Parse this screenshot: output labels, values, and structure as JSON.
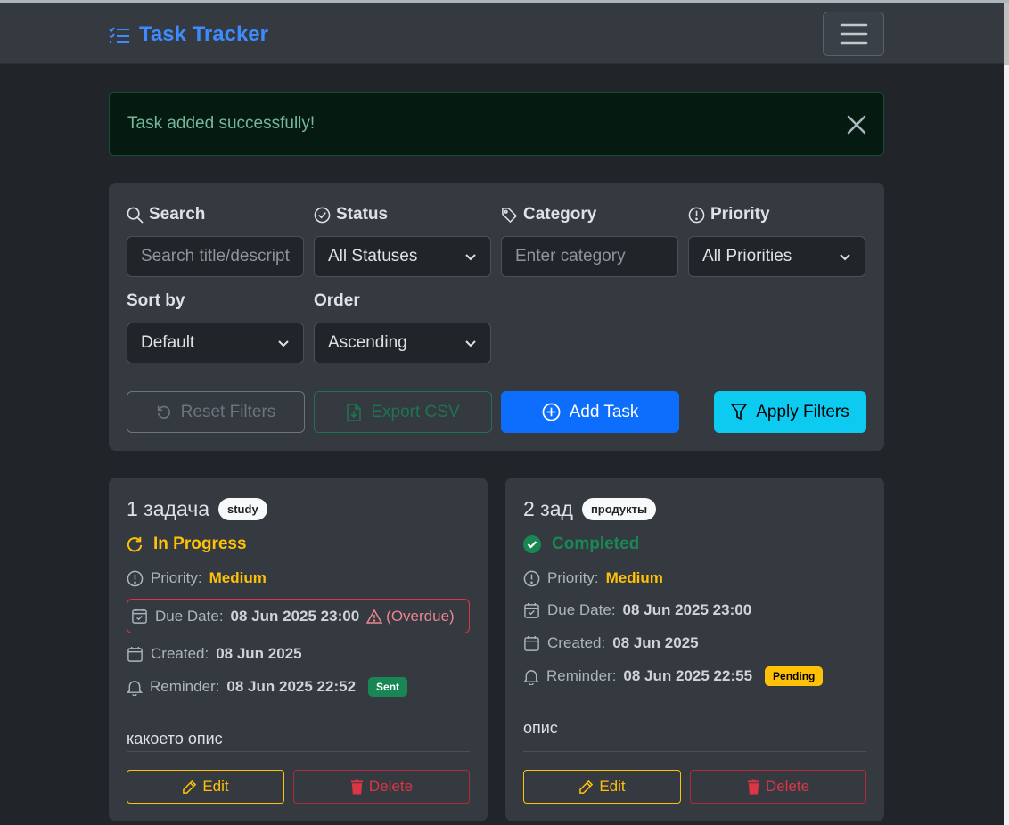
{
  "app": {
    "title": "Task Tracker",
    "accent": "#3d8bfd"
  },
  "alert": {
    "message": "Task added successfully!"
  },
  "filters": {
    "search": {
      "label": "Search",
      "placeholder": "Search title/description"
    },
    "status": {
      "label": "Status",
      "value": "All Statuses"
    },
    "category": {
      "label": "Category",
      "placeholder": "Enter category"
    },
    "priority": {
      "label": "Priority",
      "value": "All Priorities"
    },
    "sort_by": {
      "label": "Sort by",
      "value": "Default"
    },
    "order": {
      "label": "Order",
      "value": "Ascending"
    },
    "buttons": {
      "reset": "Reset Filters",
      "export": "Export CSV",
      "add": "Add Task",
      "apply": "Apply Filters"
    }
  },
  "tasks": [
    {
      "title": "1 задача",
      "category": "study",
      "status": "In Progress",
      "status_color": "#ffc107",
      "priority_label": "Priority:",
      "priority": "Medium",
      "due_label": "Due Date:",
      "due": "08 Jun 2025 23:00",
      "overdue_note": "(Overdue)",
      "created_label": "Created:",
      "created": "08 Jun 2025",
      "reminder_label": "Reminder:",
      "reminder": "08 Jun 2025 22:52",
      "reminder_badge": "Sent",
      "description": "какоето опис",
      "edit_label": "Edit",
      "delete_label": "Delete"
    },
    {
      "title": "2 зад",
      "category": "продукты",
      "status": "Completed",
      "status_color": "#198754",
      "priority_label": "Priority:",
      "priority": "Medium",
      "due_label": "Due Date:",
      "due": "08 Jun 2025 23:00",
      "created_label": "Created:",
      "created": "08 Jun 2025",
      "reminder_label": "Reminder:",
      "reminder": "08 Jun 2025 22:55",
      "reminder_badge": "Pending",
      "description": "опис",
      "edit_label": "Edit",
      "delete_label": "Delete"
    }
  ]
}
